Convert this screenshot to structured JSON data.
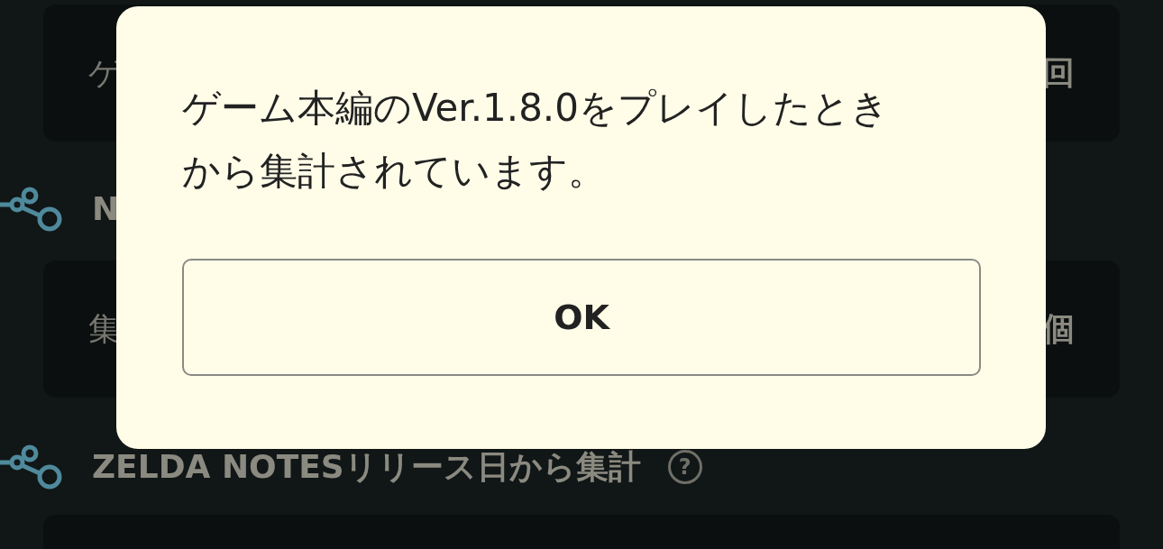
{
  "background": {
    "cards": [
      {
        "left": "ゲ",
        "right": "回"
      },
      {
        "left": "集",
        "right": "個"
      }
    ],
    "headings": [
      {
        "text": "N"
      },
      {
        "text": "ZELDA NOTESリリース日から集計",
        "help": "?"
      }
    ]
  },
  "dialog": {
    "message": "ゲーム本編のVer.1.8.0をプレイしたときから集計されています。",
    "button": "OK"
  }
}
